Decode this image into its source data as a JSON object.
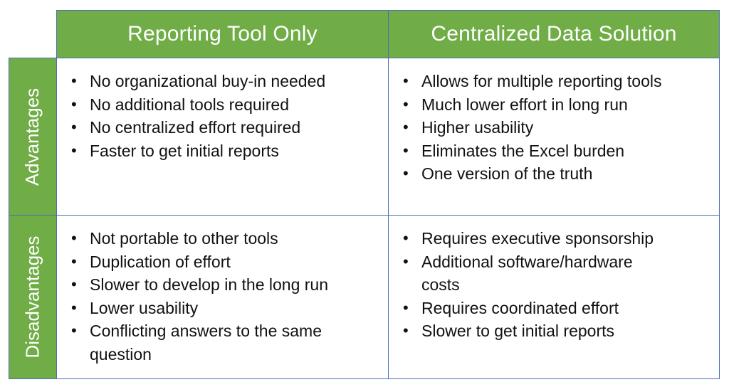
{
  "columns": [
    {
      "label": "Reporting Tool Only"
    },
    {
      "label": "Centralized Data Solution"
    }
  ],
  "rows": [
    {
      "label": "Advantages",
      "cells": [
        [
          "No organizational buy-in needed",
          "No additional tools required",
          "No centralized effort required",
          "Faster to get initial reports"
        ],
        [
          "Allows for multiple reporting tools",
          "Much lower effort in long run",
          "Higher usability",
          "Eliminates the Excel burden",
          "One version of the truth"
        ]
      ]
    },
    {
      "label": "Disadvantages",
      "cells": [
        [
          "Not portable to other tools",
          "Duplication of effort",
          "Slower to develop in the long run",
          "Lower usability",
          "Conflicting answers to the same question"
        ],
        [
          "Requires executive sponsorship",
          "Additional software/hardware costs",
          "Requires coordinated effort",
          "Slower to get initial reports"
        ]
      ]
    }
  ],
  "colors": {
    "header_green": "#70ad47",
    "border_blue": "#4a6fb5"
  }
}
